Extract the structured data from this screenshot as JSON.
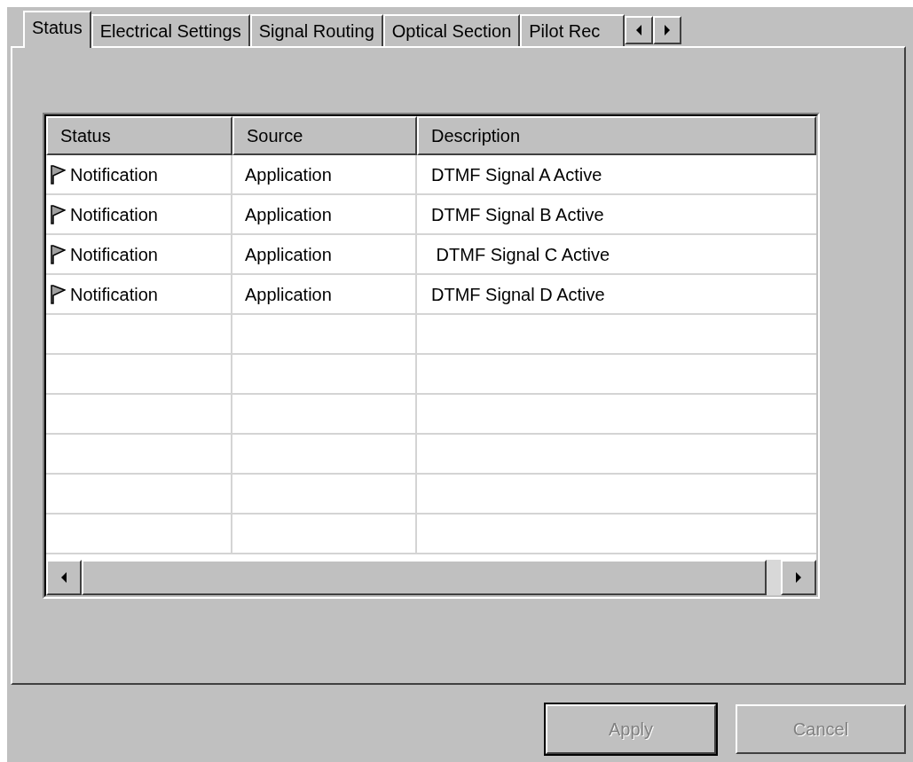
{
  "tabs": [
    {
      "label": "Status",
      "selected": true
    },
    {
      "label": "Electrical Settings",
      "selected": false
    },
    {
      "label": "Signal Routing",
      "selected": false
    },
    {
      "label": "Optical Section",
      "selected": false
    },
    {
      "label": "Pilot Rec",
      "selected": false
    }
  ],
  "table": {
    "columns": [
      "Status",
      "Source",
      "Description"
    ],
    "rows": [
      {
        "status": "Notification",
        "source": "Application",
        "description": "DTMF Signal A Active"
      },
      {
        "status": "Notification",
        "source": "Application",
        "description": "DTMF Signal B Active"
      },
      {
        "status": "Notification",
        "source": "Application",
        "description": " DTMF Signal C Active"
      },
      {
        "status": "Notification",
        "source": "Application",
        "description": "DTMF Signal D Active"
      }
    ]
  },
  "buttons": [
    {
      "label": "Apply",
      "disabled": true,
      "default": true
    },
    {
      "label": "Cancel",
      "disabled": true,
      "default": false
    }
  ]
}
